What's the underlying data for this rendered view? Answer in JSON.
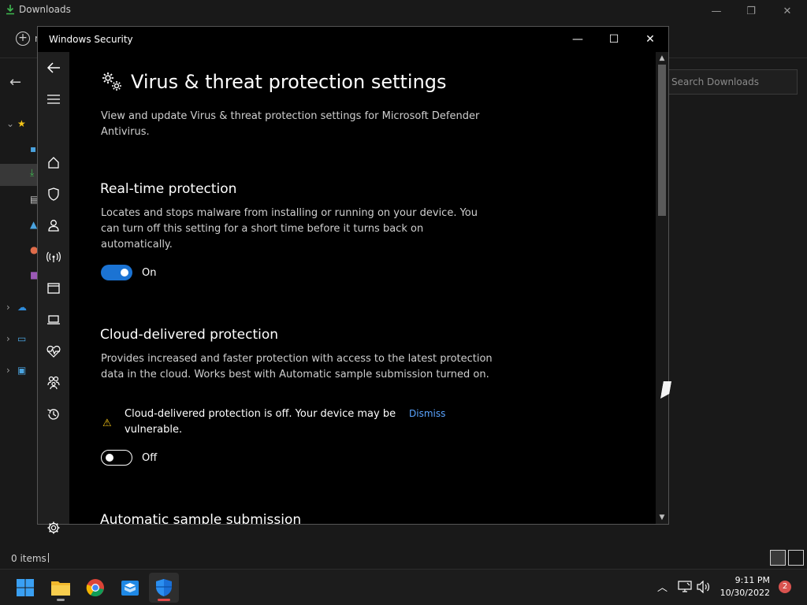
{
  "explorer": {
    "title": "Downloads",
    "new_label": "n",
    "search_placeholder": "Search Downloads",
    "status": "0 items",
    "controls": {
      "minimize": "—",
      "maximize": "❐",
      "close": "✕"
    }
  },
  "security": {
    "window_title": "Windows Security",
    "page_title": "Virus & threat protection settings",
    "page_desc": "View and update Virus & threat protection settings for Microsoft Defender Antivirus.",
    "sections": [
      {
        "title": "Real-time protection",
        "desc": "Locates and stops malware from installing or running on your device. You can turn off this setting for a short time before it turns back on automatically.",
        "toggle_state": "on",
        "toggle_label": "On"
      },
      {
        "title": "Cloud-delivered protection",
        "desc": "Provides increased and faster protection with access to the latest protection data in the cloud. Works best with Automatic sample submission turned on.",
        "warning": "Cloud-delivered protection is off. Your device may be vulnerable.",
        "dismiss": "Dismiss",
        "toggle_state": "off",
        "toggle_label": "Off"
      },
      {
        "title": "Automatic sample submission"
      }
    ],
    "sidebar_icons": [
      "back-icon",
      "menu-icon",
      "home-icon",
      "shield-icon",
      "account-icon",
      "network-icon",
      "app-browser-icon",
      "device-security-icon",
      "health-icon",
      "family-icon",
      "history-icon",
      "settings-icon"
    ]
  },
  "taskbar": {
    "time": "9:11 PM",
    "date": "10/30/2022",
    "notifications": "2"
  },
  "colors": {
    "accent": "#1b73d3",
    "warning": "#f5c518",
    "link": "#5aa4ff"
  }
}
